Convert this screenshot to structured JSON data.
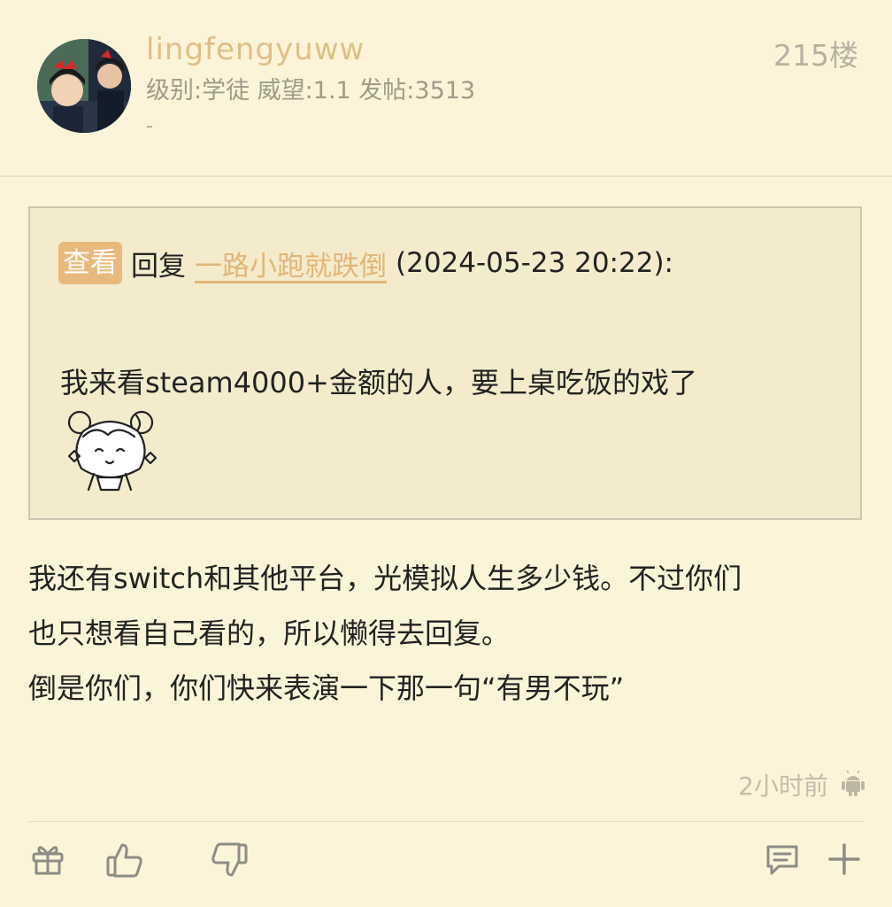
{
  "post": {
    "username": "lingfengyuww",
    "meta": "级别:学徒  威望:1.1  发帖:3513",
    "signature": "-",
    "floor": "215楼",
    "quote": {
      "view_badge": "查看",
      "reply_label": "回复",
      "quoted_user": "一路小跑就跌倒",
      "datetime": "(2024-05-23 20:22):",
      "text": "我来看steam4000+金额的人，要上桌吃饭的戏了"
    },
    "body_lines": [
      "我还有switch和其他平台，光模拟人生多少钱。不过你们",
      "也只想看自己看的，所以懒得去回复。",
      "倒是你们，你们快来表演一下那一句“有男不玩”"
    ],
    "time": "2小时前"
  },
  "icons": {
    "gift": "gift-icon",
    "like": "thumbs-up-icon",
    "dislike": "thumbs-down-icon",
    "comment": "comment-icon",
    "add": "plus-icon",
    "platform": "android-icon"
  },
  "colors": {
    "background": "#fbf4d8",
    "username": "#e0bf86",
    "badge": "#e8b97d",
    "quote_bg": "#f3ebcc"
  }
}
